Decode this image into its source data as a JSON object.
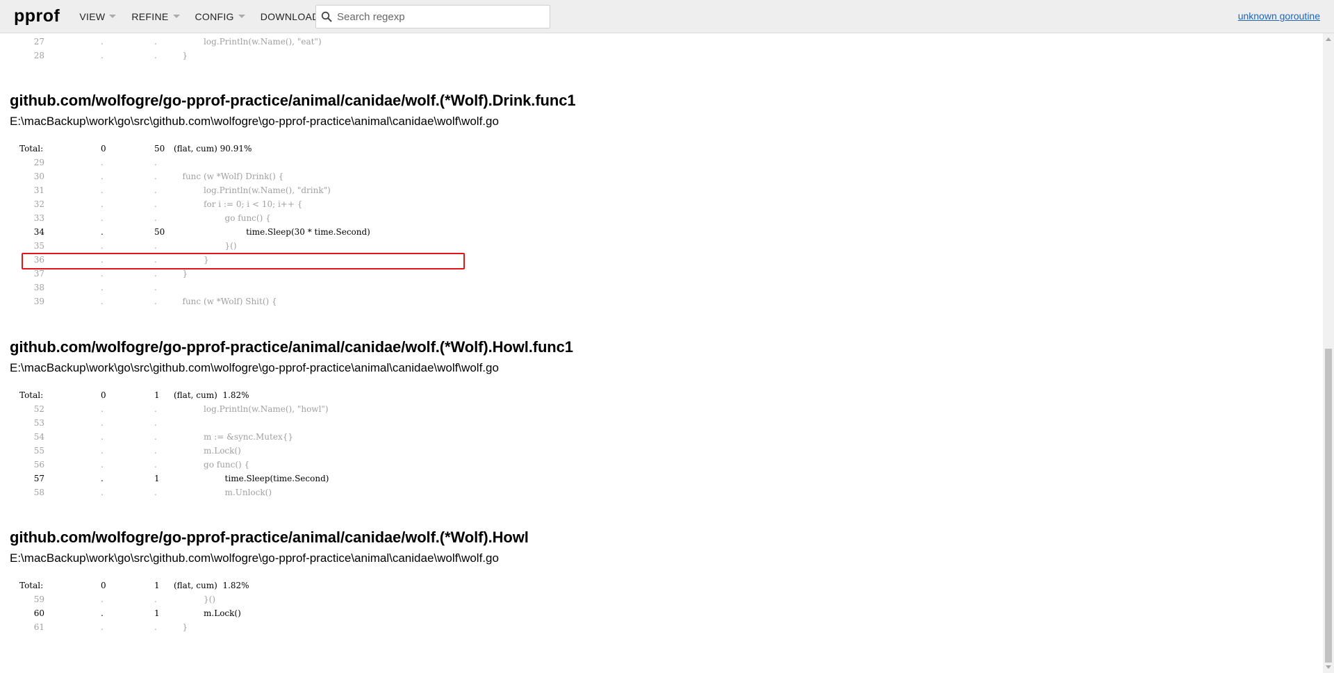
{
  "header": {
    "logo": "pprof",
    "menu": [
      {
        "label": "VIEW",
        "has_caret": true
      },
      {
        "label": "REFINE",
        "has_caret": true
      },
      {
        "label": "CONFIG",
        "has_caret": true
      },
      {
        "label": "DOWNLOAD",
        "has_caret": false
      }
    ],
    "search_placeholder": "Search regexp",
    "search_value": "",
    "user_link": "unknown goroutine"
  },
  "top_lines": [
    {
      "line": "27",
      "flat": ".",
      "cum": ".",
      "code": "                log.Println(w.Name(), \"eat\")",
      "dim": true
    },
    {
      "line": "28",
      "flat": ".",
      "cum": ".",
      "code": "        }",
      "dim": true
    }
  ],
  "sections": [
    {
      "title": "github.com/wolfogre/go-pprof-practice/animal/canidae/wolf.(*Wolf).Drink.func1",
      "file": "E:\\macBackup\\work\\go\\src\\github.com\\wolfogre\\go-pprof-practice\\animal\\canidae\\wolf\\wolf.go",
      "total": {
        "label": "Total:",
        "flat": "0",
        "cum": "50",
        "summary": "(flat, cum) 90.91%"
      },
      "lines": [
        {
          "line": "29",
          "flat": ".",
          "cum": ".",
          "code": "",
          "dim": true
        },
        {
          "line": "30",
          "flat": ".",
          "cum": ".",
          "code": "        func (w *Wolf) Drink() {",
          "dim": true
        },
        {
          "line": "31",
          "flat": ".",
          "cum": ".",
          "code": "                log.Println(w.Name(), \"drink\")",
          "dim": true
        },
        {
          "line": "32",
          "flat": ".",
          "cum": ".",
          "code": "                for i := 0; i < 10; i++ {",
          "dim": true
        },
        {
          "line": "33",
          "flat": ".",
          "cum": ".",
          "code": "                        go func() {",
          "dim": true
        },
        {
          "line": "34",
          "flat": ".",
          "cum": "50",
          "code": "                                time.Sleep(30 * time.Second)",
          "dim": false,
          "highlighted": true
        },
        {
          "line": "35",
          "flat": ".",
          "cum": ".",
          "code": "                        }()",
          "dim": true
        },
        {
          "line": "36",
          "flat": ".",
          "cum": ".",
          "code": "                }",
          "dim": true
        },
        {
          "line": "37",
          "flat": ".",
          "cum": ".",
          "code": "        }",
          "dim": true
        },
        {
          "line": "38",
          "flat": ".",
          "cum": ".",
          "code": "",
          "dim": true
        },
        {
          "line": "39",
          "flat": ".",
          "cum": ".",
          "code": "        func (w *Wolf) Shit() {",
          "dim": true
        }
      ]
    },
    {
      "title": "github.com/wolfogre/go-pprof-practice/animal/canidae/wolf.(*Wolf).Howl.func1",
      "file": "E:\\macBackup\\work\\go\\src\\github.com\\wolfogre\\go-pprof-practice\\animal\\canidae\\wolf\\wolf.go",
      "total": {
        "label": "Total:",
        "flat": "0",
        "cum": "1",
        "summary": "(flat, cum)  1.82%"
      },
      "lines": [
        {
          "line": "52",
          "flat": ".",
          "cum": ".",
          "code": "                log.Println(w.Name(), \"howl\")",
          "dim": true
        },
        {
          "line": "53",
          "flat": ".",
          "cum": ".",
          "code": "",
          "dim": true
        },
        {
          "line": "54",
          "flat": ".",
          "cum": ".",
          "code": "                m := &sync.Mutex{}",
          "dim": true
        },
        {
          "line": "55",
          "flat": ".",
          "cum": ".",
          "code": "                m.Lock()",
          "dim": true
        },
        {
          "line": "56",
          "flat": ".",
          "cum": ".",
          "code": "                go func() {",
          "dim": true
        },
        {
          "line": "57",
          "flat": ".",
          "cum": "1",
          "code": "                        time.Sleep(time.Second)",
          "dim": false
        },
        {
          "line": "58",
          "flat": ".",
          "cum": ".",
          "code": "                        m.Unlock()",
          "dim": true
        }
      ]
    },
    {
      "title": "github.com/wolfogre/go-pprof-practice/animal/canidae/wolf.(*Wolf).Howl",
      "file": "E:\\macBackup\\work\\go\\src\\github.com\\wolfogre\\go-pprof-practice\\animal\\canidae\\wolf\\wolf.go",
      "total": {
        "label": "Total:",
        "flat": "0",
        "cum": "1",
        "summary": "(flat, cum)  1.82%"
      },
      "lines": [
        {
          "line": "59",
          "flat": ".",
          "cum": ".",
          "code": "                }()",
          "dim": true
        },
        {
          "line": "60",
          "flat": ".",
          "cum": "1",
          "code": "                m.Lock()",
          "dim": false
        },
        {
          "line": "61",
          "flat": ".",
          "cum": ".",
          "code": "        }",
          "dim": true
        }
      ]
    }
  ],
  "colors": {
    "header_bg": "#eeeeee",
    "link": "#1a66b8",
    "highlight_border": "#e0161b",
    "dim_text": "#a0a0a0"
  }
}
